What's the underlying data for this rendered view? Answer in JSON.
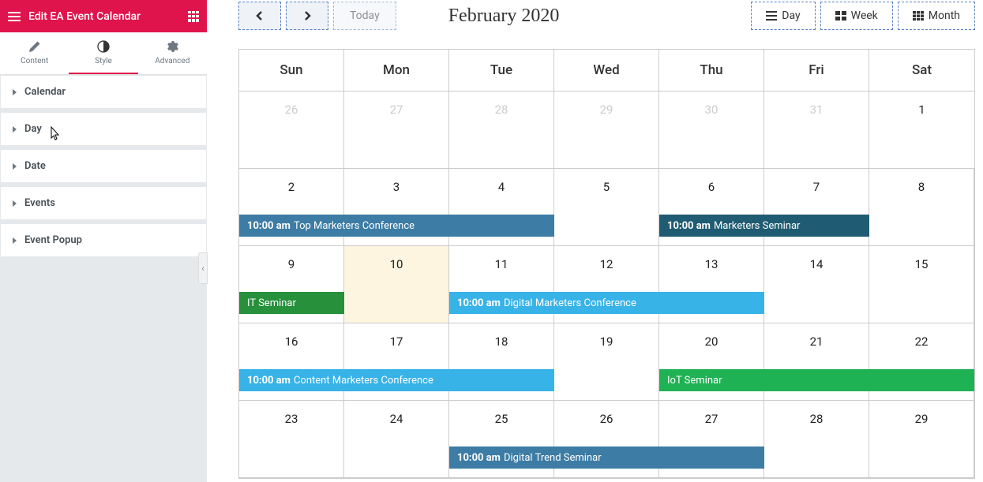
{
  "sidebar": {
    "title": "Edit EA Event Calendar",
    "tabs": [
      {
        "label": "Content",
        "icon": "pencil",
        "active": false
      },
      {
        "label": "Style",
        "icon": "contrast",
        "active": true
      },
      {
        "label": "Advanced",
        "icon": "gear",
        "active": false
      }
    ],
    "sections": [
      {
        "label": "Calendar"
      },
      {
        "label": "Day"
      },
      {
        "label": "Date"
      },
      {
        "label": "Events"
      },
      {
        "label": "Event Popup"
      }
    ]
  },
  "calendar": {
    "title": "February 2020",
    "todayLabel": "Today",
    "views": [
      {
        "label": "Day",
        "icon": "day"
      },
      {
        "label": "Week",
        "icon": "week"
      },
      {
        "label": "Month",
        "icon": "month"
      }
    ],
    "dow": [
      "Sun",
      "Mon",
      "Tue",
      "Wed",
      "Thu",
      "Fri",
      "Sat"
    ],
    "weeks": [
      {
        "days": [
          "26",
          "27",
          "28",
          "29",
          "30",
          "31",
          "1"
        ],
        "otherMask": [
          1,
          1,
          1,
          1,
          1,
          1,
          0
        ],
        "events": []
      },
      {
        "days": [
          "2",
          "3",
          "4",
          "5",
          "6",
          "7",
          "8"
        ],
        "events": [
          {
            "startCol": 0,
            "span": 3,
            "color": "blue",
            "time": "10:00 am",
            "title": "Top Marketers Conference"
          },
          {
            "startCol": 4,
            "span": 2,
            "color": "mid",
            "time": "10:00 am",
            "title": "Marketers Seminar"
          }
        ]
      },
      {
        "days": [
          "9",
          "10",
          "11",
          "12",
          "13",
          "14",
          "15"
        ],
        "todayCol": 1,
        "events": [
          {
            "startCol": 0,
            "span": 1,
            "color": "green",
            "time": "",
            "title": "IT Seminar"
          },
          {
            "startCol": 2,
            "span": 3,
            "color": "light",
            "time": "10:00 am",
            "title": "Digital Marketers Conference"
          }
        ]
      },
      {
        "days": [
          "16",
          "17",
          "18",
          "19",
          "20",
          "21",
          "22"
        ],
        "events": [
          {
            "startCol": 0,
            "span": 3,
            "color": "light",
            "time": "10:00 am",
            "title": "Content Marketers Conference"
          },
          {
            "startCol": 4,
            "span": 3,
            "color": "bright",
            "time": "",
            "title": "IoT Seminar"
          }
        ]
      },
      {
        "days": [
          "23",
          "24",
          "25",
          "26",
          "27",
          "28",
          "29"
        ],
        "events": [
          {
            "startCol": 2,
            "span": 3,
            "color": "blue",
            "time": "10:00 am",
            "title": "Digital Trend Seminar"
          }
        ]
      }
    ]
  }
}
